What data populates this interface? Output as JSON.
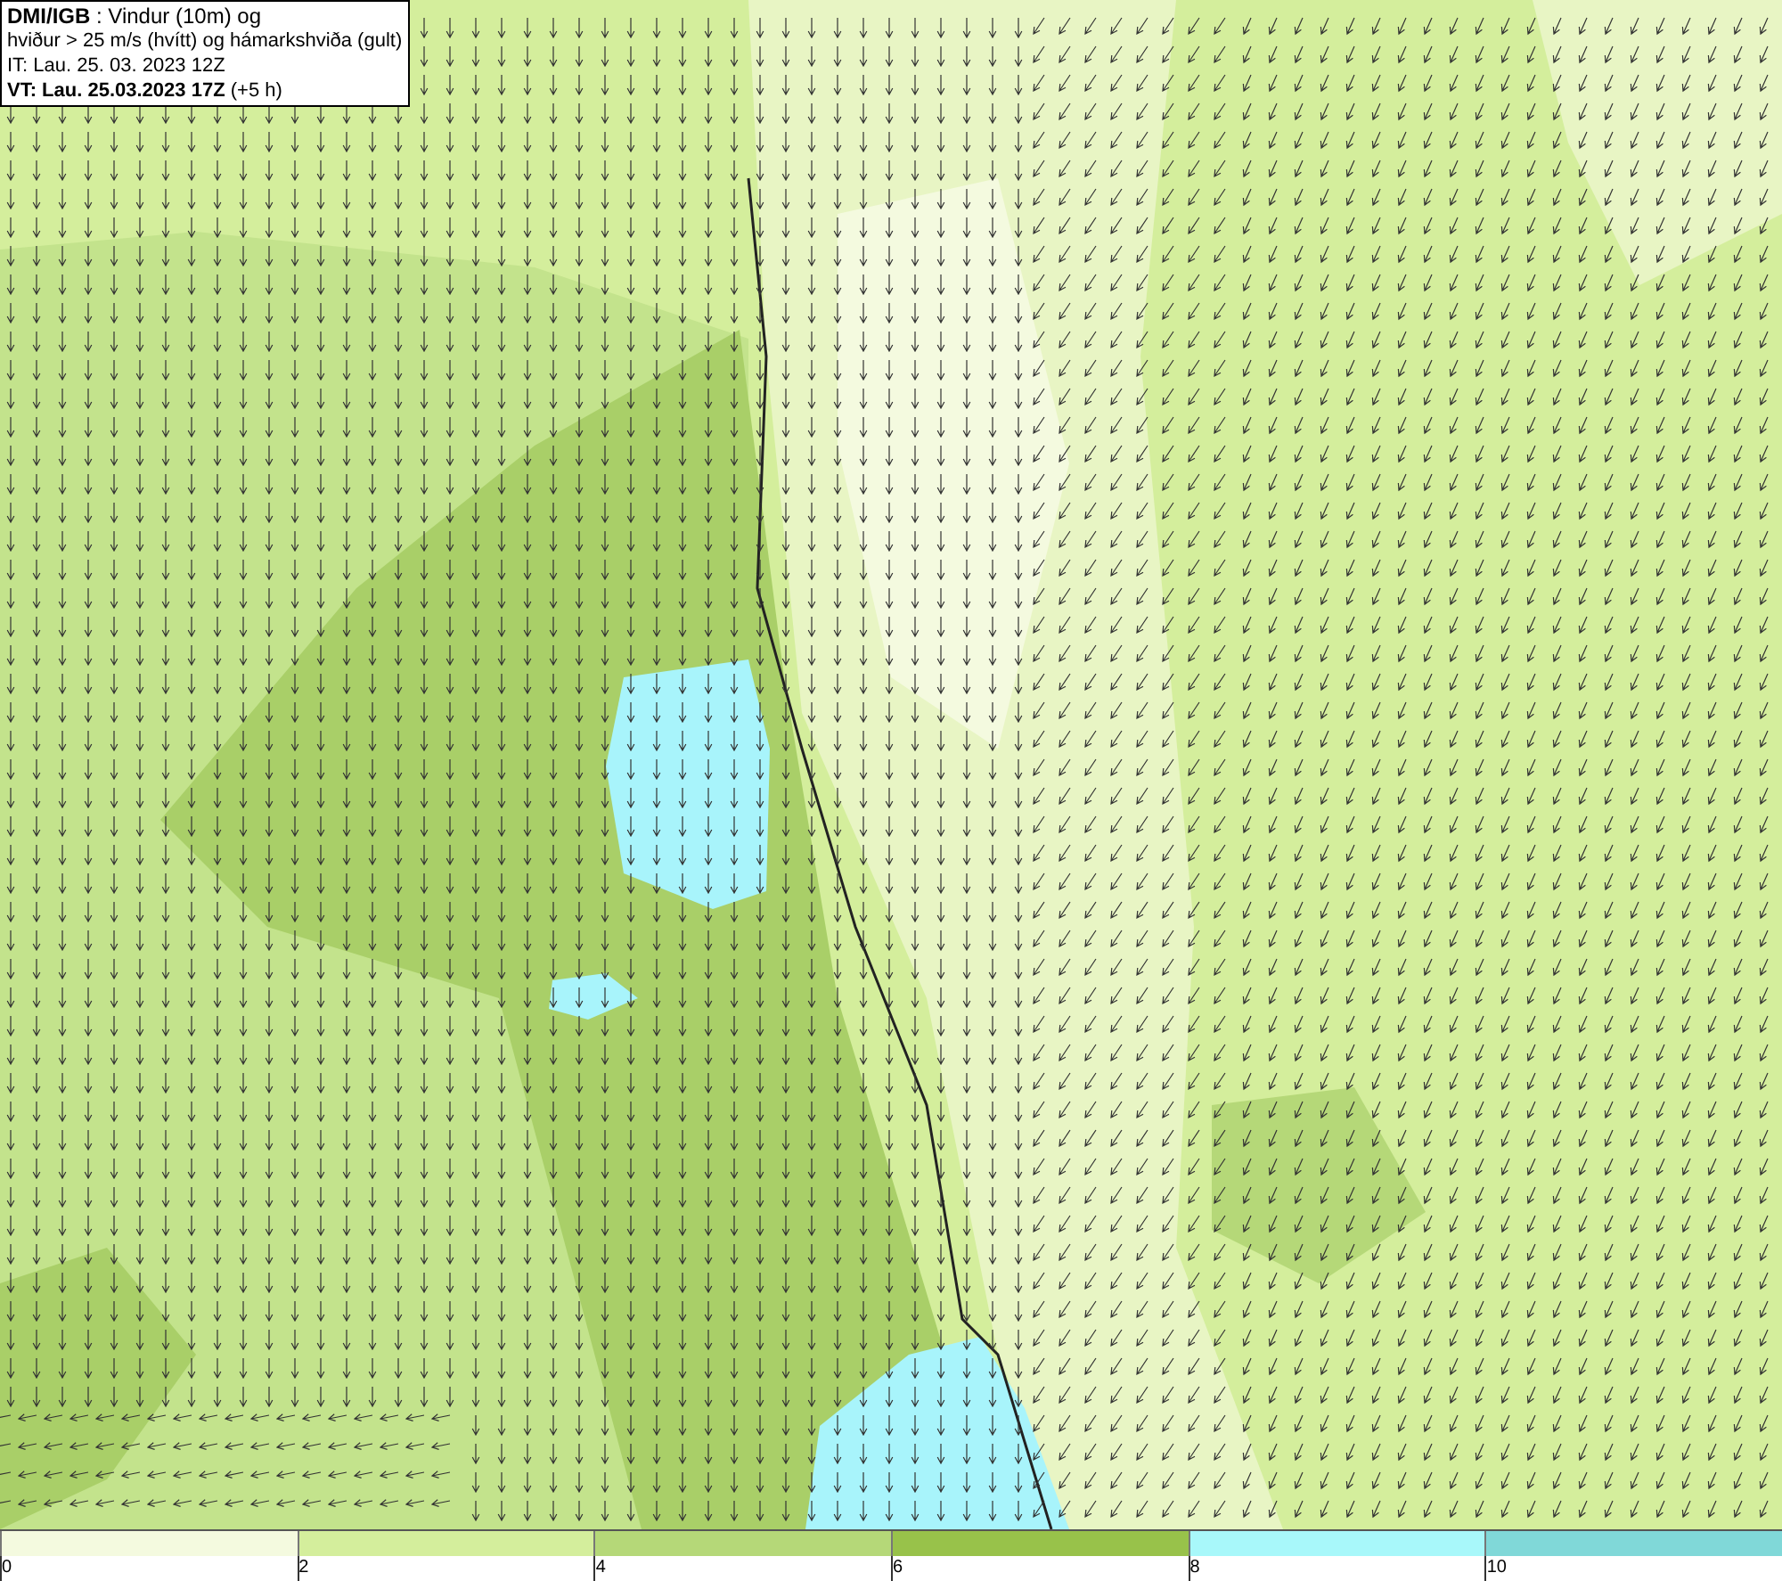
{
  "title_box": {
    "lines": [
      "**DMI/IGB** : Vindur (10m) og",
      "hviður > 25 m/s (hvítt) og hámarkshviða (gult)",
      "IT: Lau. 25. 03. 2023 12Z",
      "**VT: Lau. 25.03.2023 17Z** (+5 h)"
    ]
  },
  "color_scale": {
    "bins": [
      {
        "color": "#f4fadf"
      },
      {
        "color": "#d4ee9c"
      },
      {
        "color": "#b5d878"
      },
      {
        "color": "#98c24a"
      },
      {
        "color": "#a8f8fa"
      },
      {
        "color": "#80d8d8"
      }
    ],
    "ticks": [
      "0",
      "2",
      "4",
      "6",
      "8",
      "10"
    ]
  }
}
